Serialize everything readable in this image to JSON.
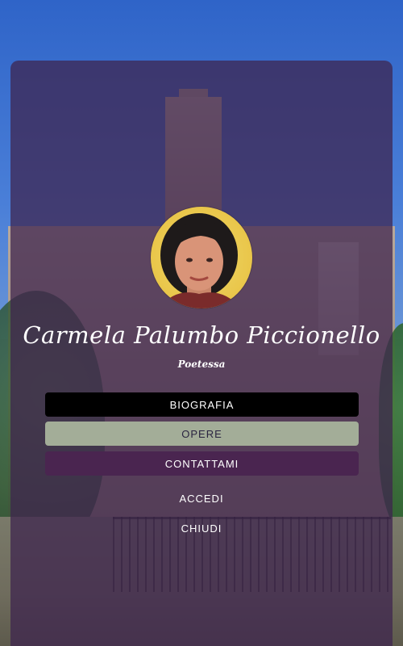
{
  "profile": {
    "name": "Carmela Palumbo Piccionello",
    "subtitle": "Poetessa"
  },
  "menu": {
    "buttons": [
      {
        "label": "BIOGRAFIA",
        "style": "dark"
      },
      {
        "label": "OPERE",
        "style": "active"
      },
      {
        "label": "CONTATTAMI",
        "style": "purple"
      }
    ],
    "links": [
      {
        "label": "ACCEDI"
      },
      {
        "label": "CHIUDI"
      }
    ]
  },
  "colors": {
    "overlay": "#3e244e",
    "button_dark": "#000000",
    "button_active": "#a3ad98",
    "button_purple": "#4a2550",
    "text": "#ffffff"
  }
}
